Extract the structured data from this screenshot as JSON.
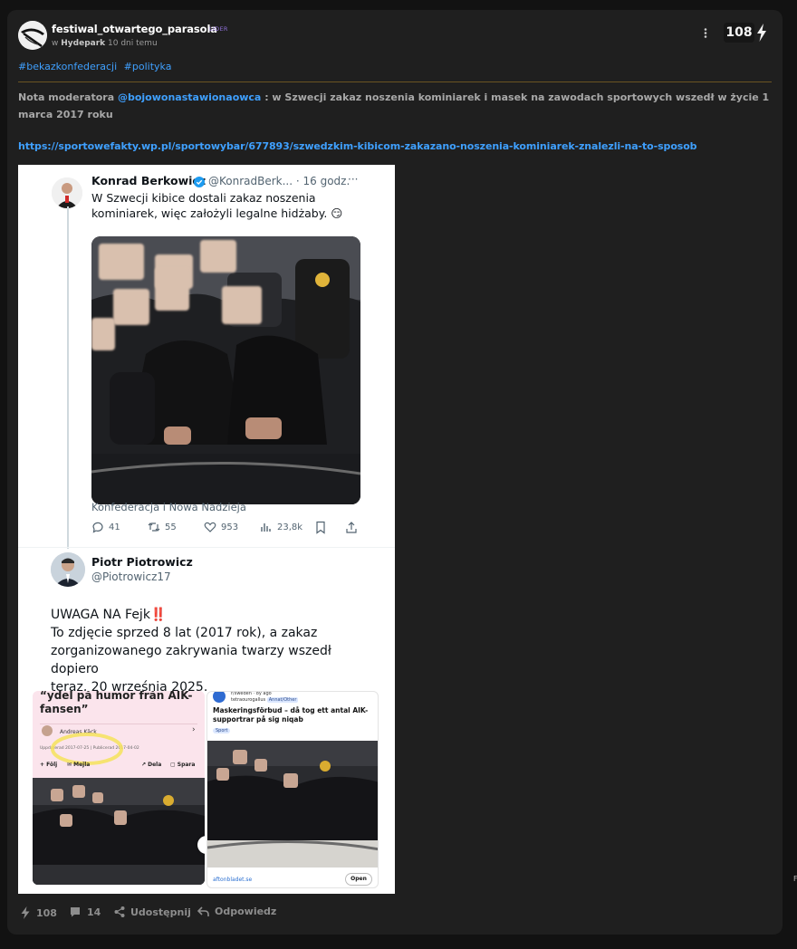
{
  "post": {
    "username": "festiwal_otwartego_parasola",
    "rank_badge": "LIDER",
    "meta_prefix": "w",
    "community": "Hydepark",
    "time_ago": "10 dni temu",
    "score": "108",
    "tags": [
      "#bekazkonfederacji",
      "#polityka"
    ],
    "note_label": "Nota moderatora",
    "note_mention": "@bojowonastawionaowca",
    "note_text": " : w Szwecji zakaz noszenia kominiarek i masek na zawodach sportowych wszedł w życie 1 marca 2017 roku",
    "link": "https://sportowefakty.wp.pl/sportowybar/677893/szwedzkim-kibicom-zakazano-noszenia-kominiarek-znalezli-na-to-sposob"
  },
  "embed": {
    "tweet1": {
      "name": "Konrad Berkowicz",
      "handle_time": "@KonradBerk... · 16 godz.",
      "more": "···",
      "text_line1": "W Szwecji kibice dostali zakaz noszenia",
      "text_line2": "kominiarek, więc założyli legalne hidżaby. 😏",
      "caption": "Konfederacja i Nowa Nadzieja",
      "replies": "41",
      "retweets": "55",
      "likes": "953",
      "views": "23,8k"
    },
    "tweet2": {
      "name": "Piotr Piotrowicz",
      "handle": "@Piotrowicz17",
      "line1": "UWAGA NA Fejk",
      "line1_emoji": "‼️",
      "line2": "To zdjęcie sprzed 8 lat (2017 rok), a zakaz",
      "line3": "zorganizowanego zakrywania twarzy wszedł dopiero",
      "line4": "teraz, 20 września 2025."
    },
    "article_left": {
      "headline_line1": "“ydel på humor från AIK-",
      "headline_line2": "fansen”",
      "author": "Andreas Käck",
      "dates": "Uppdaterad 2017-07-25 | Publicerad 2017-04-02",
      "share1": "Följ",
      "share2": "Mejla",
      "share3": "Dela",
      "share4": "Spara"
    },
    "article_right": {
      "top_line": "r/sweden · 8y ago",
      "user": "tetraourogallus",
      "flair": "Annat/Other",
      "headline": "Maskeringsförbud – då tog ett antal AIK-supportrar på sig niqab",
      "tag": "Sport",
      "source": "aftonbladet.se",
      "open": "Open"
    }
  },
  "footer": {
    "votes": "108",
    "comments": "14",
    "share": "Udostępnij",
    "reply": "Odpowiedz"
  },
  "edge_mark": "F"
}
